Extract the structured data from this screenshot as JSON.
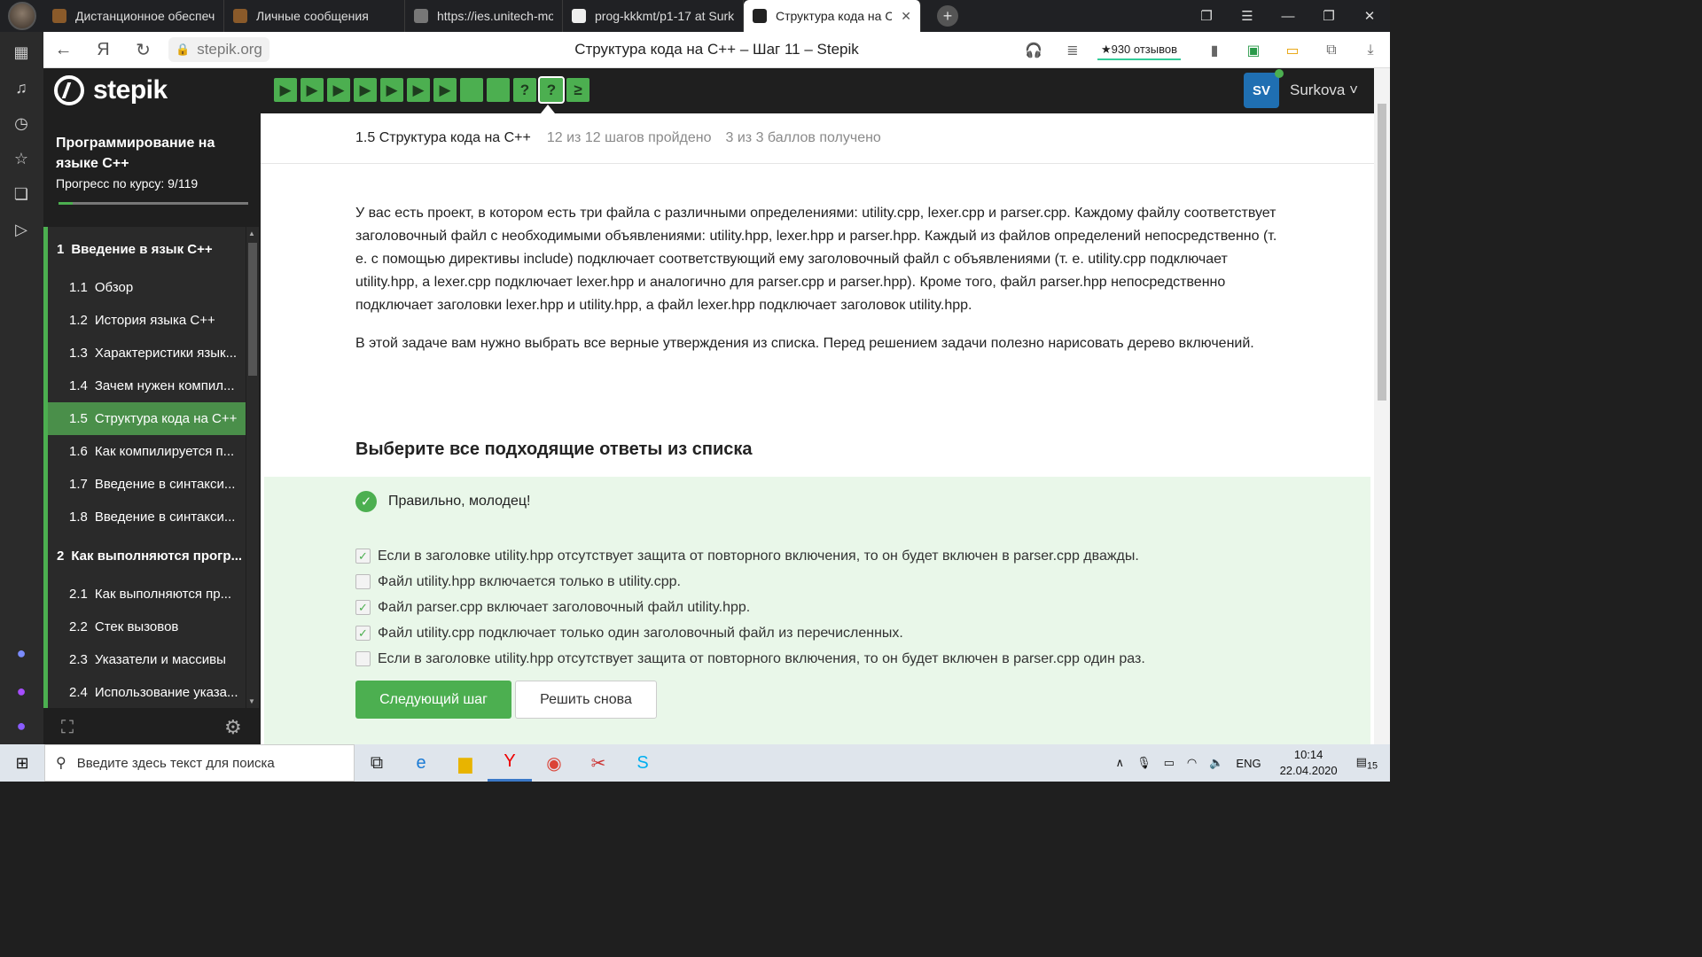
{
  "browser": {
    "tabs": [
      {
        "label": "Дистанционное обеспече",
        "color": "#8a5a2a"
      },
      {
        "label": "Личные сообщения",
        "color": "#8a5a2a"
      },
      {
        "label": "https://ies.unitech-mo.ru/fi",
        "color": "#777777"
      },
      {
        "label": "prog-kkkmt/p1-17 at Surk",
        "color": "#eeeeee"
      },
      {
        "label": "Структура кода на С++",
        "color": "#222222",
        "active": true
      }
    ],
    "url": "stepik.org",
    "page_title": "Структура кода на С++ – Шаг 11 – Stepik",
    "reviews": "★930 отзывов",
    "badge_count": "15"
  },
  "stepik": {
    "logo": "stepik",
    "steps": [
      "▶",
      "▶",
      "▶",
      "▶",
      "▶",
      "▶",
      "▶",
      "",
      "",
      "?",
      "?",
      "≥"
    ],
    "user_initials": "SV",
    "user_name": "Surkova ˅"
  },
  "sidebar": {
    "course_title": "Программирование на языке С++",
    "progress_text": "Прогресс по курсу:  9/119",
    "progress_fraction": 0.076,
    "toc": [
      {
        "type": "module",
        "num": "1",
        "label": "Введение в язык С++"
      },
      {
        "type": "lesson",
        "num": "1.1",
        "label": "Обзор"
      },
      {
        "type": "lesson",
        "num": "1.2",
        "label": "История языка С++"
      },
      {
        "type": "lesson",
        "num": "1.3",
        "label": "Характеристики язык..."
      },
      {
        "type": "lesson",
        "num": "1.4",
        "label": "Зачем нужен компил..."
      },
      {
        "type": "lesson",
        "num": "1.5",
        "label": "Структура кода на С++",
        "active": true
      },
      {
        "type": "lesson",
        "num": "1.6",
        "label": "Как компилируется п..."
      },
      {
        "type": "lesson",
        "num": "1.7",
        "label": "Введение в синтакси..."
      },
      {
        "type": "lesson",
        "num": "1.8",
        "label": "Введение в синтакси..."
      },
      {
        "type": "module",
        "num": "2",
        "label": "Как выполняются прогр..."
      },
      {
        "type": "lesson",
        "num": "2.1",
        "label": "Как выполняются пр..."
      },
      {
        "type": "lesson",
        "num": "2.2",
        "label": "Стек вызовов"
      },
      {
        "type": "lesson",
        "num": "2.3",
        "label": "Указатели и массивы"
      },
      {
        "type": "lesson",
        "num": "2.4",
        "label": "Использование указа..."
      }
    ]
  },
  "lesson_bar": {
    "name": "1.5 Структура кода на С++",
    "steps_done": "12 из 12 шагов пройдено",
    "score": "3 из 3 баллов  получено"
  },
  "content": {
    "p1": "У вас есть проект, в котором есть три файла с различными определениями: utility.cpp, lexer.cpp и parser.cpp. Каждому файлу соответствует заголовочный файл с необходимыми объявлениями: utility.hpp, lexer.hpp и parser.hpp. Каждый из файлов определений непосредственно (т. е. с помощью директивы include) подключает соответствующий ему заголовочный файл с объявлениями (т. е. utility.cpp подключает utility.hpp, a lexer.cpp подключает lexer.hpp и аналогично для parser.cpp и parser.hpp). Кроме того, файл parser.hpp непосредственно подключает заголовки lexer.hpp и utility.hpp, а файл lexer.hpp подключает заголовок utility.hpp.",
    "p2": "В этой задаче вам нужно выбрать все верные утверждения из списка. Перед решением задачи полезно нарисовать дерево включений.",
    "question_title": "Выберите все подходящие ответы из списка",
    "correct_msg": "Правильно, молодец!",
    "options": [
      {
        "label": "Если в заголовке utility.hpp отсутствует защита от повторного включения, то он будет включен в parser.cpp дважды.",
        "checked": true
      },
      {
        "label": "Файл utility.hpp включается только в utility.cpp.",
        "checked": false
      },
      {
        "label": "Файл parser.cpp включает заголовочный файл utility.hpp.",
        "checked": true
      },
      {
        "label": "Файл utility.cpp подключает только один заголовочный файл из перечисленных.",
        "checked": true
      },
      {
        "label": "Если в заголовке utility.hpp отсутствует защита от повторного включения, то он будет включен в parser.cpp один раз.",
        "checked": false
      }
    ],
    "next_button": "Следующий шаг",
    "retry_button": "Решить снова"
  },
  "taskbar": {
    "search_placeholder": "Введите здесь текст для поиска",
    "lang": "ENG",
    "time": "10:14",
    "date": "22.04.2020",
    "notif_count": "15"
  }
}
